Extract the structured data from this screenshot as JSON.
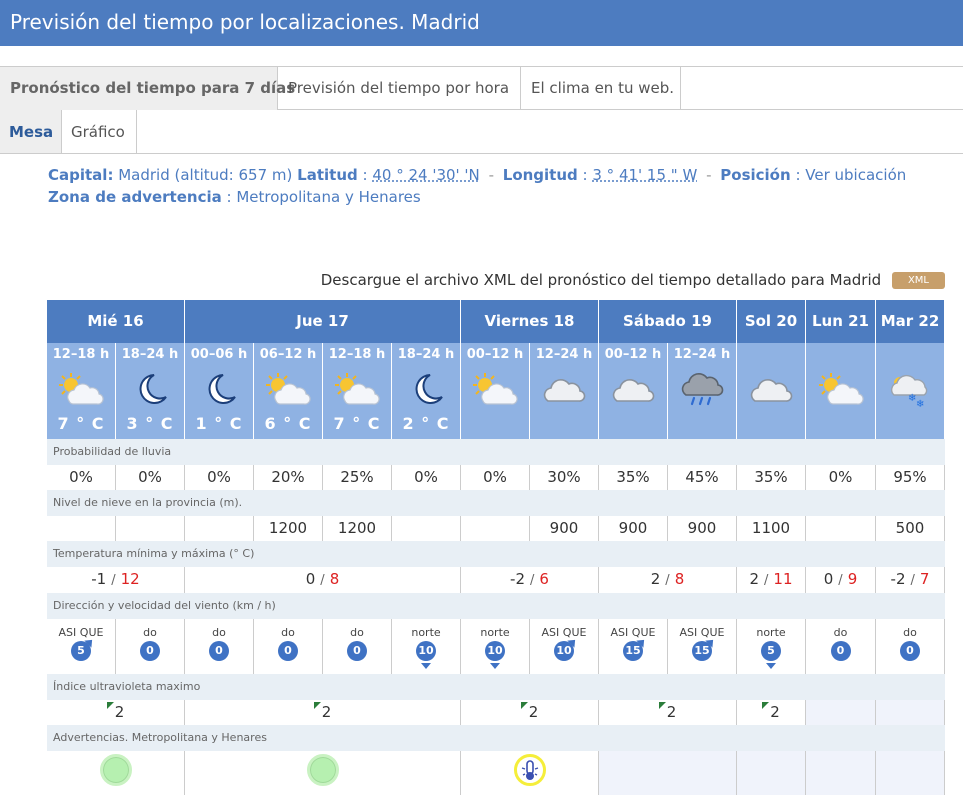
{
  "page": {
    "title": "Previsión del tiempo por localizaciones. Madrid"
  },
  "tabs": [
    "Pronóstico del tiempo para 7 días",
    "Previsión del tiempo por hora",
    "El clima en tu web."
  ],
  "subtabs": [
    "Mesa",
    "Gráfico"
  ],
  "info": {
    "capital_label": "Capital:",
    "capital_value": "Madrid (altitud: 657 m)",
    "lat_label": "Latitud",
    "lat_value": "40 ° 24 '30' 'N",
    "lon_label": "Longitud",
    "lon_value": "3 ° 41' 15 \" W",
    "pos_label": "Posición",
    "pos_value": "Ver ubicación",
    "zone_label": "Zona de advertencia",
    "zone_value": "Metropolitana y Henares"
  },
  "xml": {
    "text": "Descargue el archivo XML del pronóstico del tiempo detallado para Madrid",
    "badge": "XML"
  },
  "days": [
    "Mié 16",
    "Jue 17",
    "Viernes 18",
    "Sábado 19",
    "Sol 20",
    "Lun 21",
    "Mar 22"
  ],
  "periods": [
    {
      "label": "12–18 h",
      "icon": "sun-cloud-icon",
      "temp": "7 ° C"
    },
    {
      "label": "18–24 h",
      "icon": "moon-icon",
      "temp": "3 ° C"
    },
    {
      "label": "00–06 h",
      "icon": "moon-icon",
      "temp": "1 ° C"
    },
    {
      "label": "06–12 h",
      "icon": "sun-cloud-icon",
      "temp": "6 ° C"
    },
    {
      "label": "12–18 h",
      "icon": "sun-cloud-icon",
      "temp": "7 ° C"
    },
    {
      "label": "18–24 h",
      "icon": "moon-icon",
      "temp": "2 ° C"
    },
    {
      "label": "00–12 h",
      "icon": "sun-cloud-icon",
      "temp": ""
    },
    {
      "label": "12–24 h",
      "icon": "cloud-icon",
      "temp": ""
    },
    {
      "label": "00–12 h",
      "icon": "cloud-icon",
      "temp": ""
    },
    {
      "label": "12–24 h",
      "icon": "rain-cloud-icon",
      "temp": ""
    },
    {
      "label": "",
      "icon": "cloud-icon",
      "temp": ""
    },
    {
      "label": "",
      "icon": "sun-cloud-icon",
      "temp": ""
    },
    {
      "label": "",
      "icon": "snow-cloud-icon",
      "temp": ""
    }
  ],
  "sections": {
    "rain": "Probabilidad de lluvia",
    "snow": "Nivel de nieve en la provincia (m).",
    "temp": "Temperatura mínima y máxima (° C)",
    "wind": "Dirección y velocidad del viento (km / h)",
    "uv": "Índice ultravioleta maximo",
    "warn": "Advertencias. Metropolitana y Henares"
  },
  "rain": [
    "0%",
    "0%",
    "0%",
    "20%",
    "25%",
    "0%",
    "0%",
    "30%",
    "35%",
    "45%",
    "35%",
    "0%",
    "95%"
  ],
  "snow": [
    "",
    "",
    "",
    "1200",
    "1200",
    "",
    "",
    "900",
    "900",
    "900",
    "1100",
    "",
    "500"
  ],
  "temps": [
    {
      "min": "-1",
      "max": "12"
    },
    {
      "min": "0",
      "max": "8"
    },
    {
      "min": "-2",
      "max": "6"
    },
    {
      "min": "2",
      "max": "8"
    },
    {
      "min": "2",
      "max": "11"
    },
    {
      "min": "0",
      "max": "9"
    },
    {
      "min": "-2",
      "max": "7"
    }
  ],
  "wind": [
    {
      "dir": "ASI QUE",
      "speed": "5"
    },
    {
      "dir": "do",
      "speed": "0"
    },
    {
      "dir": "do",
      "speed": "0"
    },
    {
      "dir": "do",
      "speed": "0"
    },
    {
      "dir": "do",
      "speed": "0"
    },
    {
      "dir": "norte",
      "speed": "10"
    },
    {
      "dir": "norte",
      "speed": "10"
    },
    {
      "dir": "ASI QUE",
      "speed": "10"
    },
    {
      "dir": "ASI QUE",
      "speed": "15"
    },
    {
      "dir": "ASI QUE",
      "speed": "15"
    },
    {
      "dir": "norte",
      "speed": "5"
    },
    {
      "dir": "do",
      "speed": "0"
    },
    {
      "dir": "do",
      "speed": "0"
    }
  ],
  "uv": [
    "2",
    "2",
    "2",
    "2",
    "2",
    "",
    ""
  ],
  "warnings": [
    "green",
    "green",
    "yellow-temperature",
    "",
    "",
    "",
    ""
  ],
  "colors": {
    "header": "#4d7cc0",
    "subheader": "#8fb2e3",
    "section_bg": "#e8eff5",
    "max_temp": "#dd2222"
  }
}
